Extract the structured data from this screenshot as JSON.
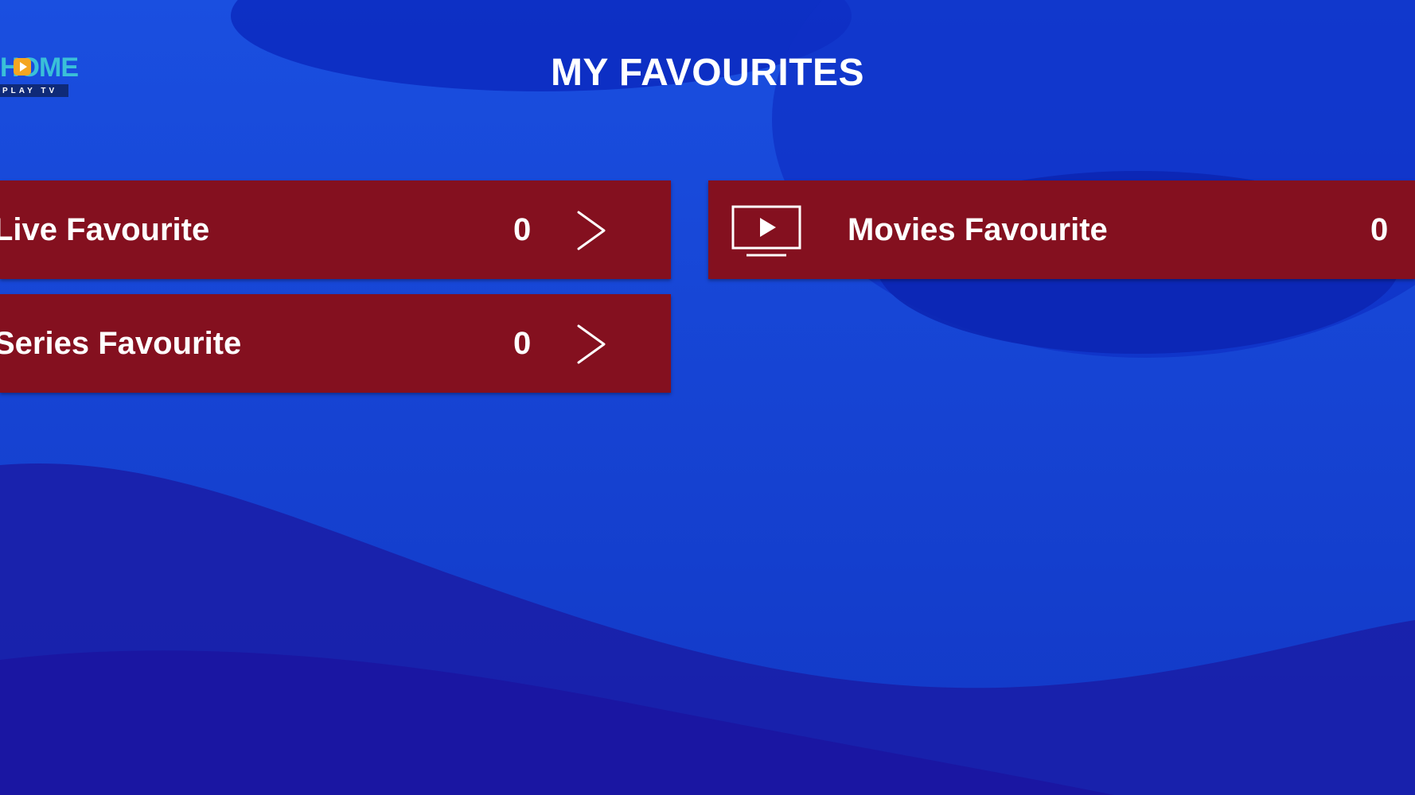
{
  "logo": {
    "wordmark": "HOME",
    "subtitle": "PLAY TV"
  },
  "header": {
    "title": "MY FAVOURITES"
  },
  "favourites": {
    "live": {
      "label": "Live Favourite",
      "count": "0",
      "icon": "chevron-right-icon"
    },
    "series": {
      "label": "Series Favourite",
      "count": "0",
      "icon": "chevron-right-icon"
    },
    "movies": {
      "label": "Movies Favourite",
      "count": "0",
      "icon": "tv-play-icon"
    }
  },
  "colors": {
    "background": "#1645d6",
    "card": "#84101f",
    "text": "#ffffff",
    "logo_accent": "#3ac0d8"
  }
}
